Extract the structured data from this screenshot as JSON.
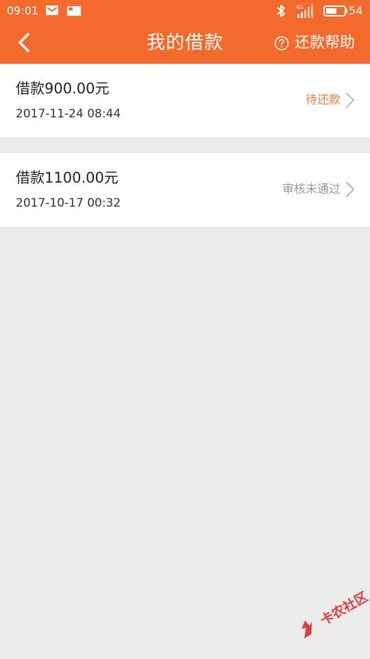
{
  "status_bar": {
    "time": "09:01",
    "battery_level": "54",
    "signal_label": "4G"
  },
  "header": {
    "title": "我的借款",
    "help_label": "还款帮助"
  },
  "loans": [
    {
      "title": "借款900.00元",
      "date": "2017-11-24 08:44",
      "status": "待还款"
    },
    {
      "title": "借款1100.00元",
      "date": "2017-10-17 00:32",
      "status": "审核未通过"
    }
  ],
  "watermark": {
    "text": "卡农社区"
  },
  "colors": {
    "accent": "#f36a2c",
    "status_pending": "#f07a3a",
    "status_rejected": "#9a9a9a",
    "background": "#ececec"
  }
}
